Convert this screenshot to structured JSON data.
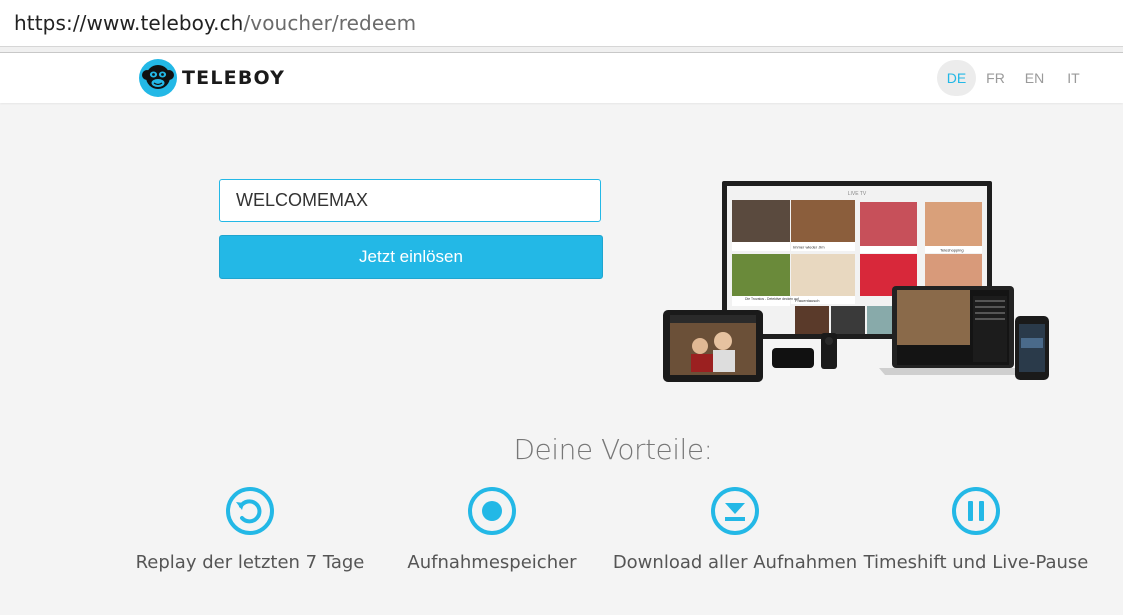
{
  "browser": {
    "url_host": "https://www.teleboy.ch",
    "url_path": "/voucher/redeem"
  },
  "header": {
    "brand": "TELEBOY",
    "languages": [
      "DE",
      "FR",
      "EN",
      "IT"
    ],
    "active_language": "DE"
  },
  "voucher": {
    "code_value": "WELCOMEMAX",
    "redeem_label": "Jetzt einlösen"
  },
  "benefits": {
    "title": "Deine Vorteile:",
    "items": [
      {
        "label": "Replay der letzten 7 Tage",
        "icon": "replay-icon"
      },
      {
        "label": "Aufnahmespeicher",
        "icon": "record-icon"
      },
      {
        "label": "Download aller Aufnahmen",
        "icon": "download-icon"
      },
      {
        "label": "Timeshift und Live-Pause",
        "icon": "pause-icon"
      }
    ]
  },
  "devices_screen": {
    "heading": "LIVE TV",
    "channels": [
      "Immer wieder Jim",
      "Teleshopping",
      "Die Trovatos - Detektive decken auf",
      "Frauentausch"
    ]
  },
  "colors": {
    "accent": "#23b8e6",
    "background": "#f4f4f4",
    "header_bg": "#ffffff"
  }
}
